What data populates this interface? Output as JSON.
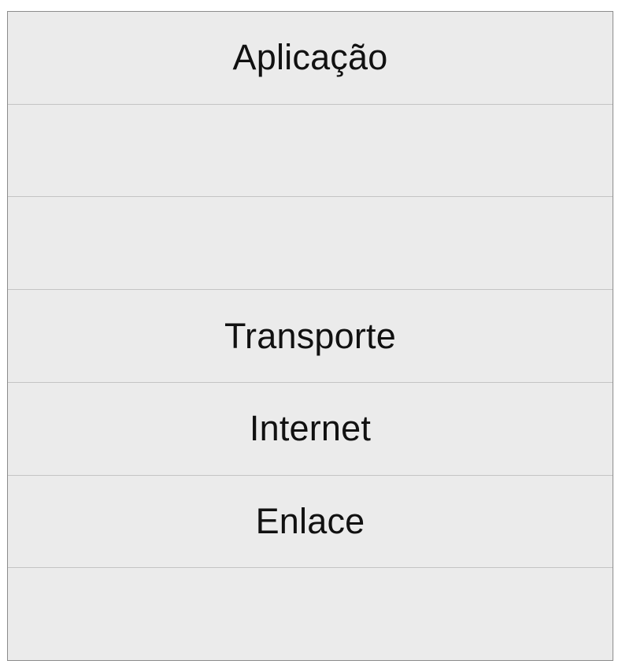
{
  "diagram": {
    "layers": [
      {
        "label": "Aplicação"
      },
      {
        "label": ""
      },
      {
        "label": ""
      },
      {
        "label": "Transporte"
      },
      {
        "label": "Internet"
      },
      {
        "label": "Enlace"
      },
      {
        "label": ""
      }
    ]
  },
  "colors": {
    "layer_fill": "#ebebeb",
    "outer_border": "#8c8c8c",
    "divider": "#c4c4c4",
    "text": "#111111"
  }
}
